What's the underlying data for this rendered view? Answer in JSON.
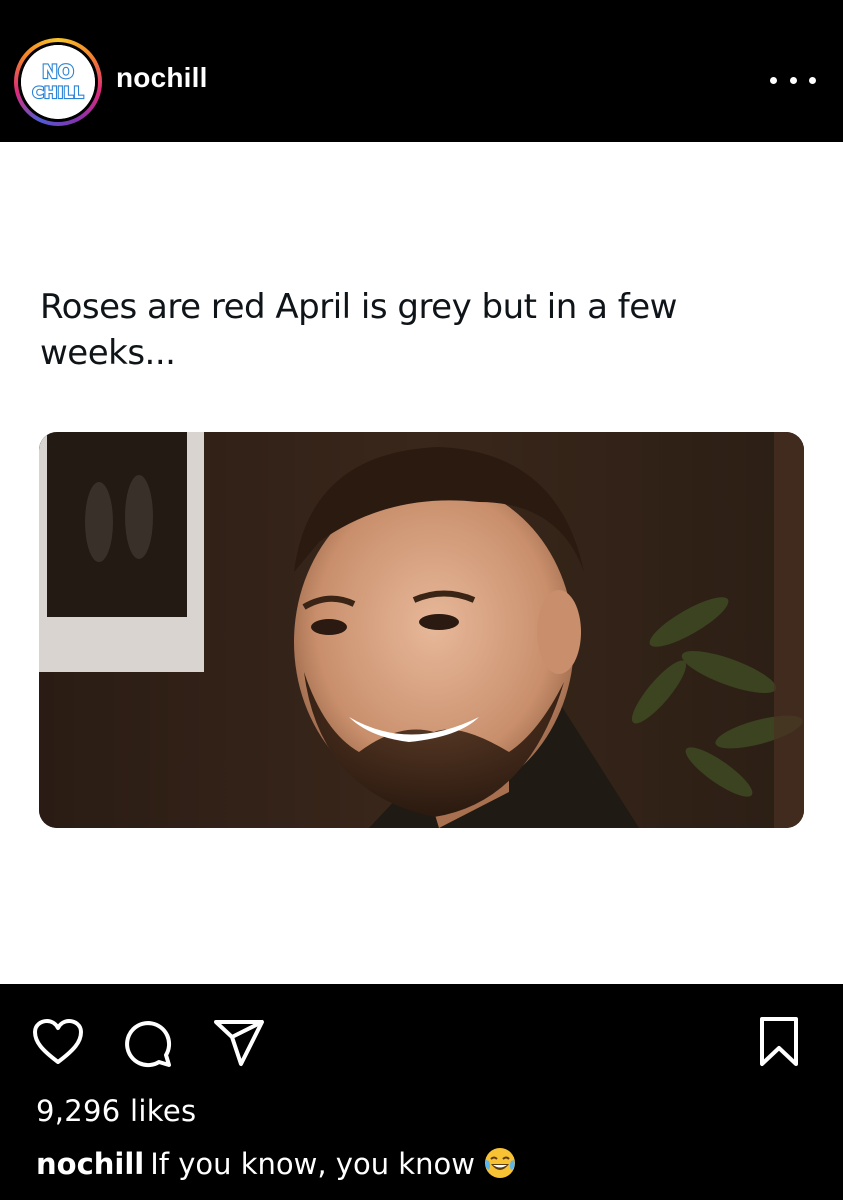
{
  "header": {
    "avatar_logo_text": [
      "NO",
      "CHILL"
    ],
    "username": "nochill"
  },
  "post": {
    "tweet_text": "Roses are red April is grey but in a few weeks...",
    "photo_description_icon": "meme-photo"
  },
  "actions": {
    "like_icon": "heart-icon",
    "comment_icon": "comment-icon",
    "share_icon": "send-icon",
    "save_icon": "bookmark-icon"
  },
  "likes": "9,296 likes",
  "caption": {
    "user": "nochill",
    "text": "If you know, you know",
    "emoji": "tears-of-joy-icon"
  },
  "colors": {
    "background": "#000000",
    "text": "#ffffff",
    "media_background": "#ffffff",
    "tweet_text": "#0f1419"
  }
}
